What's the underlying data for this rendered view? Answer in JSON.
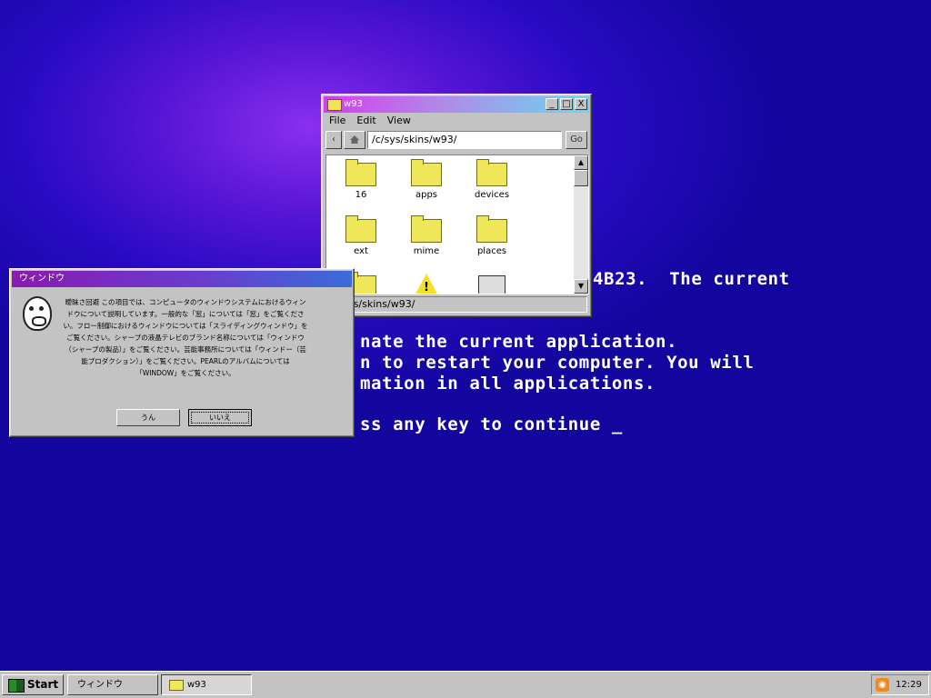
{
  "colors": {
    "desktop_bg": "#1a08b8",
    "bsod_text": "#ffffff",
    "explorer_title_gradient": [
      "#d63cf0",
      "#6ad7f2"
    ],
    "dialog_title_gradient": [
      "#8a1ab0",
      "#3a6cd8"
    ],
    "chrome": "#c3c3c3"
  },
  "bsod": {
    "line1": "4B23.  The current",
    "line2": "nate the current application.",
    "line3": "n to restart your computer. You will",
    "line4": "mation in all applications.",
    "line5": "ss any key to continue _"
  },
  "explorer": {
    "title": "w93",
    "title_icon": "folder-icon",
    "controls": {
      "minimize": "_",
      "maximize": "□",
      "close": "X"
    },
    "menu": [
      "File",
      "Edit",
      "View"
    ],
    "back_label": "‹",
    "home_icon": "home-icon",
    "address": "/c/sys/skins/w93/",
    "go_label": "Go",
    "items": [
      {
        "label": "16",
        "icon": "folder-icon"
      },
      {
        "label": "apps",
        "icon": "folder-icon"
      },
      {
        "label": "devices",
        "icon": "folder-icon"
      },
      {
        "label": "ext",
        "icon": "folder-icon"
      },
      {
        "label": "mime",
        "icon": "folder-icon"
      },
      {
        "label": "places",
        "icon": "folder-icon"
      },
      {
        "label": "",
        "icon": "folder-icon"
      },
      {
        "label": "",
        "icon": "warning-icon"
      },
      {
        "label": "",
        "icon": "device-icon"
      }
    ],
    "status": "/c/sys/skins/w93/"
  },
  "dialog": {
    "title": "ウィンドウ",
    "icon": "troll-face-icon",
    "message": "曖昧さ回避 この項目では、コンピュータのウィンドウシステムにおけるウィンドウについて説明しています。一般的な「窓」については「窓」をご覧ください。フロー制御におけるウィンドウについては「スライディングウィンドウ」をご覧ください。シャープの液晶テレビのブランド名称については「ウィンドウ（シャープの製品）」をご覧ください。芸能事務所については「ウィンドー（芸能プロダクション）」をご覧ください。PEARLのアルバムについては「WINDOW」をご覧ください。",
    "buttons": {
      "yes": "うん",
      "no": "いいえ"
    }
  },
  "taskbar": {
    "start_label": "Start",
    "start_icon": "windows-logo-icon",
    "tasks": [
      {
        "label": "ウィンドウ",
        "icon": ""
      },
      {
        "label": "w93",
        "icon": "folder-icon"
      }
    ],
    "tray_icon": "rss-icon",
    "clock": "12:29"
  }
}
